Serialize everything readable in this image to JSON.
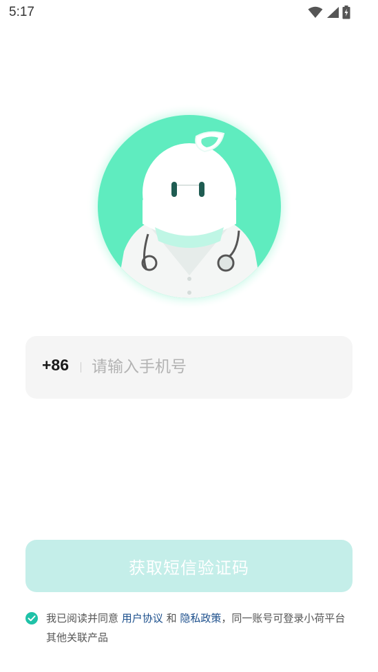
{
  "status_bar": {
    "time": "5:17",
    "icons": [
      "wifi-icon",
      "signal-icon",
      "battery-charging-icon"
    ]
  },
  "mascot": {
    "icon": "doctor-mascot-illustration"
  },
  "phone": {
    "country_code": "+86",
    "placeholder": "请输入手机号",
    "value": ""
  },
  "sms_button": {
    "label": "获取短信验证码"
  },
  "agreement": {
    "checked": true,
    "prefix": "我已阅读并同意",
    "user_agreement": "用户协议",
    "and": "和",
    "privacy_policy": "隐私政策",
    "suffix": "，同一账号可登录小荷平台其他关联产品"
  },
  "colors": {
    "accent": "#1fc2a8",
    "button_disabled": "#c4eee9",
    "link": "#1c4f8c",
    "input_bg": "#f5f5f5"
  }
}
